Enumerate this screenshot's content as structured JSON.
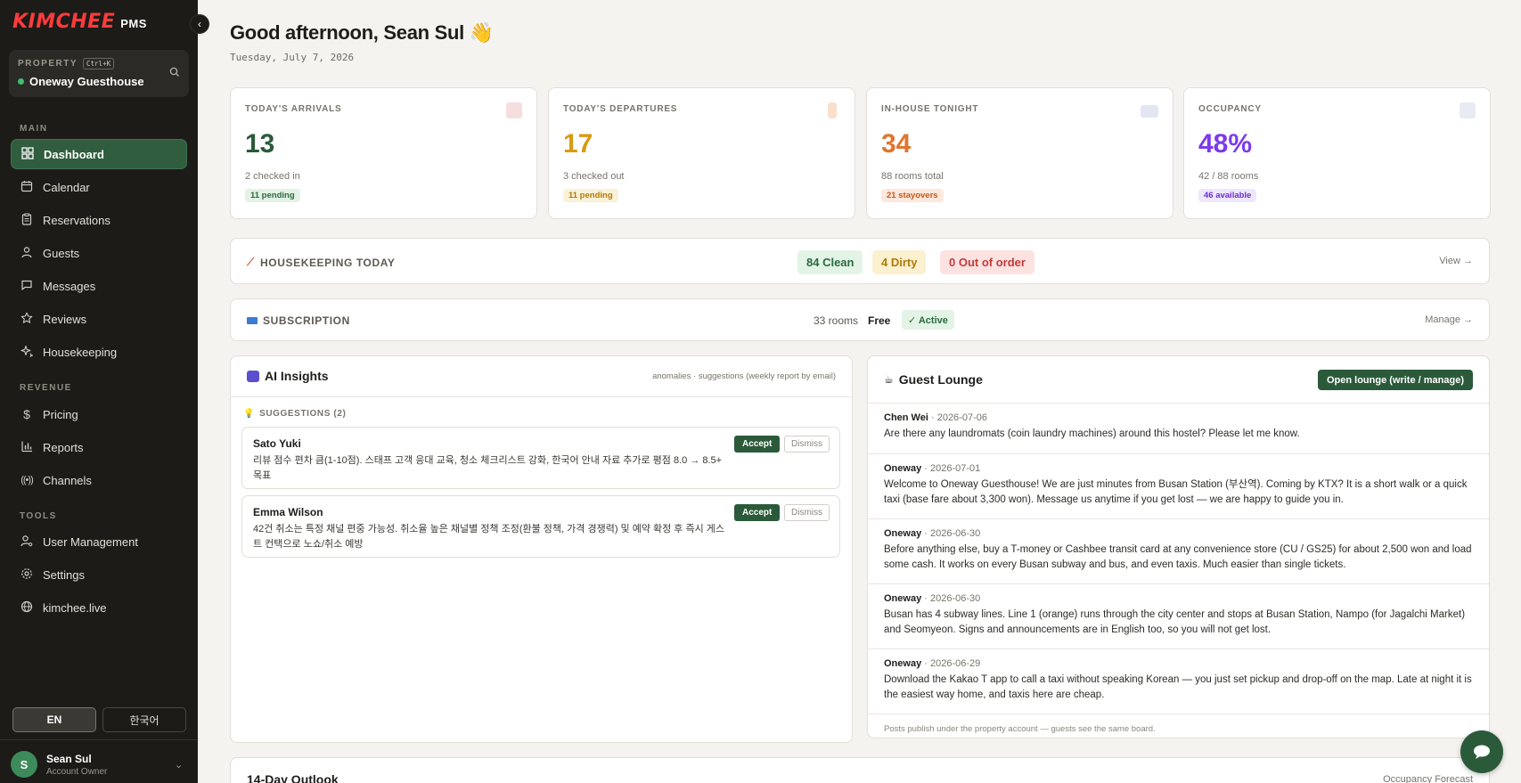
{
  "app": {
    "logo_main": "KIMCHEE",
    "logo_sub": "PMS"
  },
  "property": {
    "label": "PROPERTY",
    "shortcut": "Ctrl+K",
    "name": "Oneway Guesthouse"
  },
  "nav": {
    "main_label": "MAIN",
    "main": [
      {
        "label": "Dashboard",
        "icon": "grid-icon",
        "active": true
      },
      {
        "label": "Calendar",
        "icon": "calendar-icon"
      },
      {
        "label": "Reservations",
        "icon": "clipboard-icon"
      },
      {
        "label": "Guests",
        "icon": "users-icon"
      },
      {
        "label": "Messages",
        "icon": "message-icon"
      },
      {
        "label": "Reviews",
        "icon": "star-icon"
      },
      {
        "label": "Housekeeping",
        "icon": "sparkle-icon"
      }
    ],
    "revenue_label": "REVENUE",
    "revenue": [
      {
        "label": "Pricing",
        "icon": "dollar-icon"
      },
      {
        "label": "Reports",
        "icon": "bar-chart-icon"
      },
      {
        "label": "Channels",
        "icon": "broadcast-icon"
      }
    ],
    "tools_label": "TOOLS",
    "tools": [
      {
        "label": "User Management",
        "icon": "user-cog-icon"
      },
      {
        "label": "Settings",
        "icon": "gear-icon"
      },
      {
        "label": "kimchee.live",
        "icon": "globe-icon"
      }
    ]
  },
  "language": {
    "en": "EN",
    "ko": "한국어",
    "selected": "EN"
  },
  "user": {
    "initial": "S",
    "name": "Sean Sul",
    "role": "Account Owner"
  },
  "header": {
    "greeting": "Good afternoon, Sean Sul 👋",
    "date": "Tuesday, July 7, 2026"
  },
  "stats": [
    {
      "title": "TODAY'S ARRIVALS",
      "value": "13",
      "sub": "2 checked in",
      "pill": "11 pending",
      "color": "#2b5a3a",
      "pill_bg": "#e3f2e6",
      "pill_fg": "#2b6a3e",
      "icon_color": "#e8a0a0"
    },
    {
      "title": "TODAY'S DEPARTURES",
      "value": "17",
      "sub": "3 checked out",
      "pill": "11 pending",
      "color": "#d99a12",
      "pill_bg": "#fbf1d6",
      "pill_fg": "#b07a08",
      "icon_color": "#f2a46a"
    },
    {
      "title": "IN-HOUSE TONIGHT",
      "value": "34",
      "sub": "88 rooms total",
      "pill": "21 stayovers",
      "color": "#e0752e",
      "pill_bg": "#fde8dc",
      "pill_fg": "#c35a1a",
      "icon_color": "#a9b8d9"
    },
    {
      "title": "OCCUPANCY",
      "value": "48%",
      "sub": "42 / 88 rooms",
      "pill": "46 available",
      "color": "#7c3aed",
      "pill_bg": "#efe7fd",
      "pill_fg": "#6b2fd6",
      "icon_color": "#b9c6d9"
    }
  ],
  "housekeeping": {
    "title": "HOUSEKEEPING TODAY",
    "clean": "84 Clean",
    "dirty": "4 Dirty",
    "ooo": "0 Out of order",
    "link": "View →"
  },
  "subscription": {
    "title": "SUBSCRIPTION",
    "rooms": "33 rooms",
    "plan": "Free",
    "status": "✓ Active",
    "link": "Manage →"
  },
  "ai": {
    "title": "AI Insights",
    "hint": "anomalies · suggestions (weekly report by email)",
    "suggestions_label": "SUGGESTIONS (2)",
    "items": [
      {
        "name": "Sato Yuki",
        "text": "리뷰 점수 편차 큼(1-10점). 스태프 고객 응대 교육, 청소 체크리스트 강화, 한국어 안내 자료 추가로 평점 8.0 → 8.5+ 목표",
        "accept": "Accept",
        "dismiss": "Dismiss"
      },
      {
        "name": "Emma Wilson",
        "text": "42건 취소는 특정 채널 편중 가능성. 취소율 높은 채널별 정책 조정(환불 정책, 가격 경쟁력) 및 예약 확정 후 즉시 게스트 컨택으로 노쇼/취소 예방",
        "accept": "Accept",
        "dismiss": "Dismiss"
      }
    ]
  },
  "lounge": {
    "title": "Guest Lounge",
    "open_button": "Open lounge (write / manage)",
    "posts": [
      {
        "author": "Chen Wei",
        "date": "· 2026-07-06",
        "body": "Are there any laundromats (coin laundry machines) around this hostel? Please let me know."
      },
      {
        "author": "Oneway",
        "date": "· 2026-07-01",
        "body": "Welcome to Oneway Guesthouse! We are just minutes from Busan Station (부산역). Coming by KTX? It is a short walk or a quick taxi (base fare about 3,300 won). Message us anytime if you get lost — we are happy to guide you in."
      },
      {
        "author": "Oneway",
        "date": "· 2026-06-30",
        "body": "Before anything else, buy a T-money or Cashbee transit card at any convenience store (CU / GS25) for about 2,500 won and load some cash. It works on every Busan subway and bus, and even taxis. Much easier than single tickets."
      },
      {
        "author": "Oneway",
        "date": "· 2026-06-30",
        "body": "Busan has 4 subway lines. Line 1 (orange) runs through the city center and stops at Busan Station, Nampo (for Jagalchi Market) and Seomyeon. Signs and announcements are in English too, so you will not get lost."
      },
      {
        "author": "Oneway",
        "date": "· 2026-06-29",
        "body": "Download the Kakao T app to call a taxi without speaking Korean — you just set pickup and drop-off on the map. Late at night it is the easiest way home, and taxis here are cheap."
      }
    ],
    "footer": "Posts publish under the property account — guests see the same board."
  },
  "outlook": {
    "title": "14-Day Outlook",
    "link": "Occupancy Forecast"
  }
}
